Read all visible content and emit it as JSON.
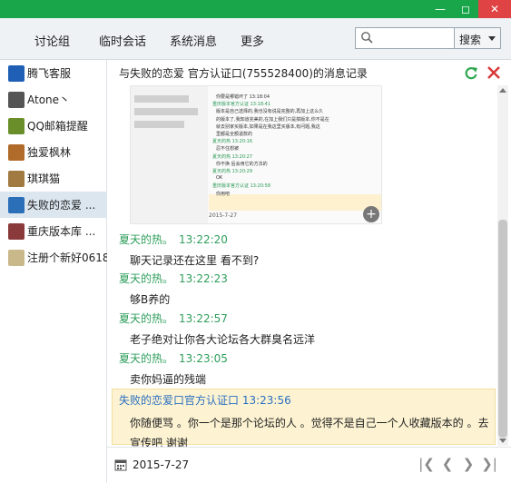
{
  "tabs": [
    "讨论组",
    "临时会话",
    "系统消息",
    "更多"
  ],
  "search": {
    "button_label": "搜索",
    "placeholder": ""
  },
  "contacts": [
    {
      "name": "腾飞客服",
      "avatar_color": "#1f5fb5",
      "avatar_label": "腾飞\n科技"
    },
    {
      "name": "Atone丶",
      "avatar_color": "#555555"
    },
    {
      "name": "QQ邮箱提醒",
      "avatar_color": "#6a8f2a"
    },
    {
      "name": "独爱枫林",
      "avatar_color": "#b06a2a"
    },
    {
      "name": "琪琪猫",
      "avatar_color": "#a07a40"
    },
    {
      "name": "失败的恋爱 ...",
      "avatar_color": "#2b6fb8"
    },
    {
      "name": "重庆版本库 ...",
      "avatar_color": "#8a3a3a"
    },
    {
      "name": "注册个新好0618",
      "avatar_color": "#c9b88a"
    }
  ],
  "active_contact_index": 5,
  "header_text": "与失败的恋爱 官方认证口(755528400)的消息记录",
  "embedded_shot": {
    "lines": [
      {
        "kind": "tx",
        "text": "你要是哪错坏了 13:18:04"
      },
      {
        "kind": "gt",
        "text": "重庆版本官方认证 13:18:41"
      },
      {
        "kind": "tx",
        "text": "版本是自己选择的,我也没有说是完整的,再加上这么久"
      },
      {
        "kind": "tx",
        "text": "的版本了,我知道完美的,在加上我们只是搞版本,你不是在"
      },
      {
        "kind": "tx",
        "text": "就去别家买版本,如果是在我这里买版本,有问题,我这"
      },
      {
        "kind": "tx",
        "text": "里都是全额退款的"
      },
      {
        "kind": "gt",
        "text": "夏天的热 13:20:16"
      },
      {
        "kind": "tx",
        "text": "忍不住想被"
      },
      {
        "kind": "gt",
        "text": "夏天的热 13:20:27"
      },
      {
        "kind": "tx",
        "text": "你不换 后会用它的方法的"
      },
      {
        "kind": "gt",
        "text": "夏天的热 13:20:29"
      },
      {
        "kind": "tx",
        "text": "OK"
      },
      {
        "kind": "gt",
        "text": "重庆版本官方认证 13:20:58"
      },
      {
        "kind": "tx",
        "text": "你用吧"
      }
    ],
    "footer": "2015-7-27"
  },
  "messages": [
    {
      "sender": "夏天的热。",
      "time": "13:22:20",
      "text": "聊天记录还在这里 看不到?"
    },
    {
      "sender": "夏天的热。",
      "time": "13:22:23",
      "text": "够B养的"
    },
    {
      "sender": "夏天的热。",
      "time": "13:22:57",
      "text": "老子绝对让你各大论坛各大群臭名远洋"
    },
    {
      "sender": "夏天的热。",
      "time": "13:23:05",
      "text": "卖你妈逼的残端"
    }
  ],
  "highlight_message": {
    "sender": "失败的恋爱口官方认证口",
    "time": "13:23:56",
    "text": "你随便骂 。你一个是那个论坛的人 。觉得不是自己一个人收藏版本的 。去宣传吧 谢谢"
  },
  "bottom": {
    "date": "2015-7-27"
  },
  "colors": {
    "title_green": "#19a64a",
    "sender_green": "#2e9e5b",
    "highlight_blue": "#2a6fc0",
    "highlight_bg": "#fdf3d2",
    "close_red": "#e04343"
  }
}
